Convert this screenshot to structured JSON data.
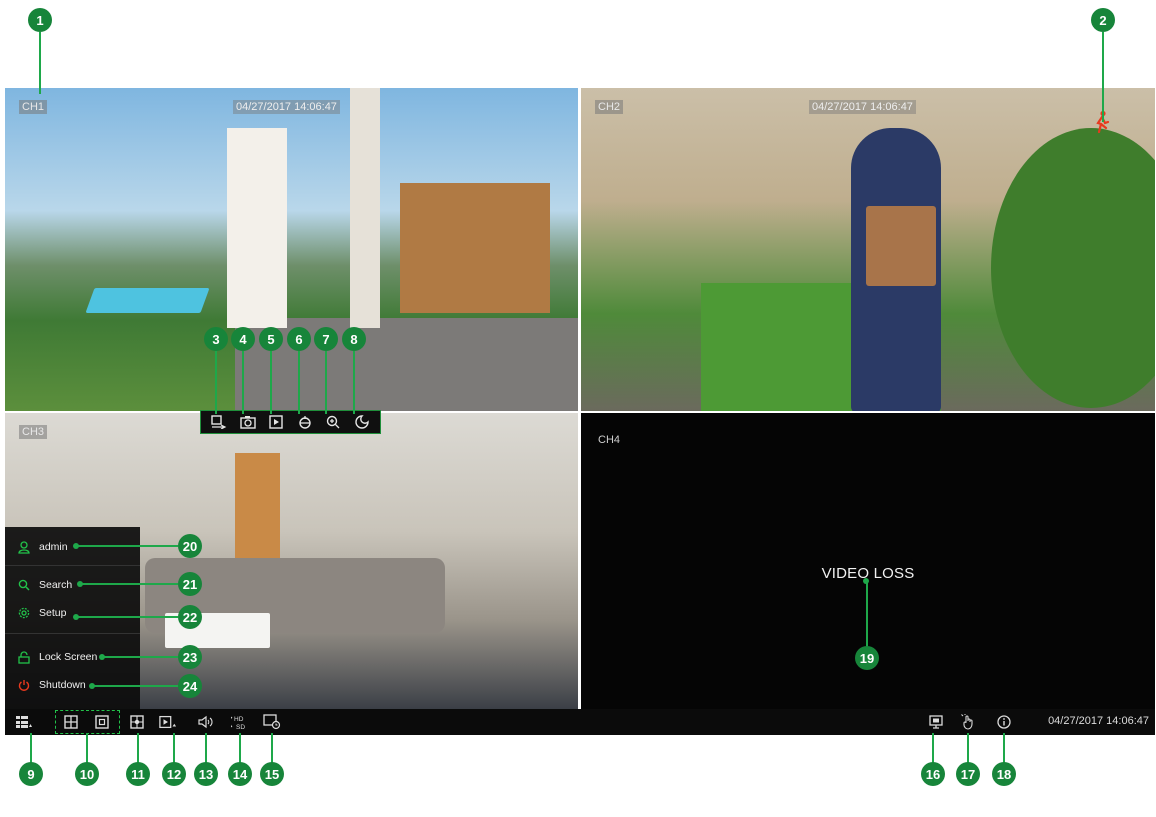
{
  "channels": [
    {
      "label": "CH1",
      "timestamp": "04/27/2017 14:06:47"
    },
    {
      "label": "CH2",
      "timestamp": "04/27/2017 14:06:47"
    },
    {
      "label": "CH3",
      "timestamp": ""
    },
    {
      "label": "CH4",
      "timestamp": "",
      "status": "VIDEO LOSS"
    }
  ],
  "quick_toolbar": {
    "icons": [
      "manual-record-icon",
      "snapshot-icon",
      "instant-playback-icon",
      "ptz-icon",
      "zoom-in-icon",
      "color-adjust-icon"
    ]
  },
  "start_menu": {
    "items": [
      {
        "label": "admin",
        "icon": "user-icon"
      },
      {
        "label": "Search",
        "icon": "search-icon"
      },
      {
        "label": "Setup",
        "icon": "gear-icon"
      },
      {
        "label": "Lock Screen",
        "icon": "lock-icon"
      },
      {
        "label": "Shutdown",
        "icon": "power-icon"
      }
    ]
  },
  "taskbar": {
    "datetime": "04/27/2017 14:06:47",
    "icons_left": [
      "start-menu-icon",
      "quad-split-icon",
      "multi-split-icon",
      "sequence-icon",
      "playback-icon",
      "audio-icon",
      "hd-sd-icon",
      "dwell-icon"
    ],
    "icons_right": [
      "output-icon",
      "gesture-icon",
      "info-icon"
    ]
  },
  "callouts": [
    "1",
    "2",
    "3",
    "4",
    "5",
    "6",
    "7",
    "8",
    "9",
    "10",
    "11",
    "12",
    "13",
    "14",
    "15",
    "16",
    "17",
    "18",
    "19",
    "20",
    "21",
    "22",
    "23",
    "24"
  ],
  "colors": {
    "accent": "#17853a",
    "toolbar_bg": "#0b0b0b",
    "video_loss_bg": "#050505"
  }
}
